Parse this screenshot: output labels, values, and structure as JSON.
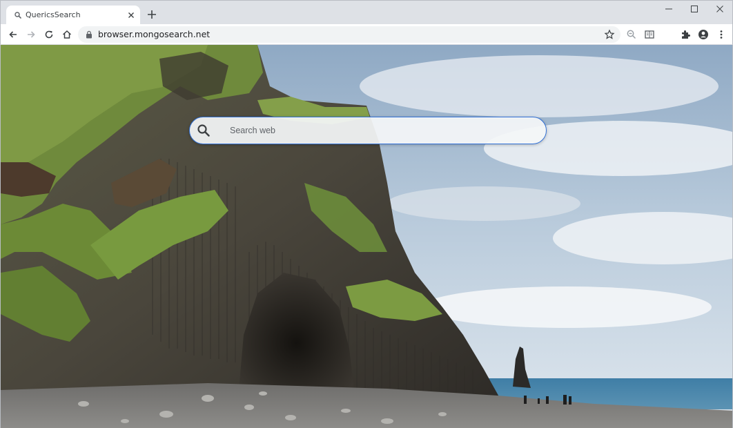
{
  "tab": {
    "title": "QuericsSearch"
  },
  "address_bar": {
    "url": "browser.mongosearch.net"
  },
  "search": {
    "placeholder": "Search web",
    "value": ""
  },
  "colors": {
    "search_border": "#2f6fd6",
    "tab_strip": "#dee1e6",
    "omnibox": "#f1f3f4"
  },
  "icons": [
    "search-icon",
    "close-icon",
    "plus-icon",
    "minimize-icon",
    "maximize-icon",
    "window-close-icon",
    "back-arrow-icon",
    "forward-arrow-icon",
    "reload-icon",
    "home-icon",
    "lock-icon",
    "star-icon",
    "zoom-icon",
    "reader-mode-icon",
    "extensions-icon",
    "profile-icon",
    "menu-dots-icon"
  ]
}
